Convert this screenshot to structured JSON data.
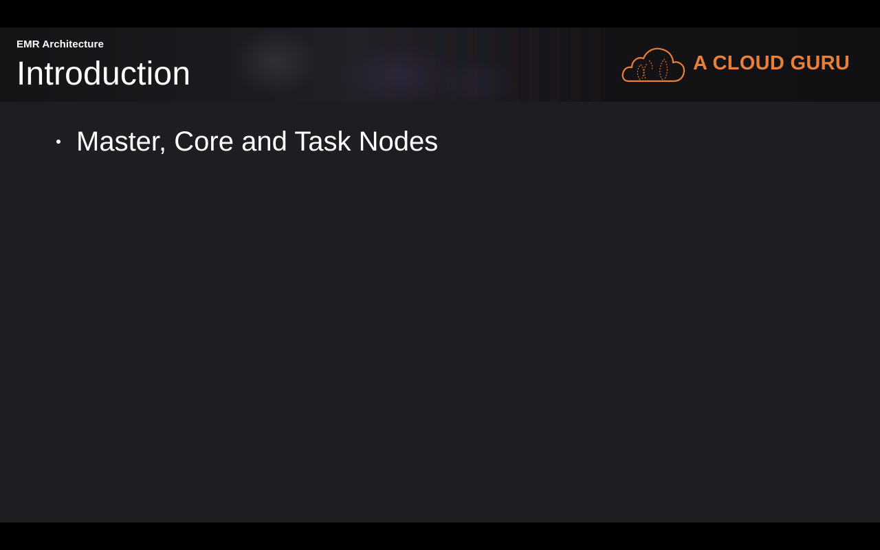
{
  "header": {
    "breadcrumb": "EMR Architecture",
    "title": "Introduction"
  },
  "logo": {
    "icon": "cloud-icon",
    "text": "A CLOUD GURU",
    "color": "#e8803a"
  },
  "content": {
    "bullets": [
      "Master, Core and Task Nodes"
    ]
  },
  "colors": {
    "background": "#1f1d21",
    "letterbox": "#000000",
    "text": "#ffffff",
    "accent": "#e8803a"
  }
}
